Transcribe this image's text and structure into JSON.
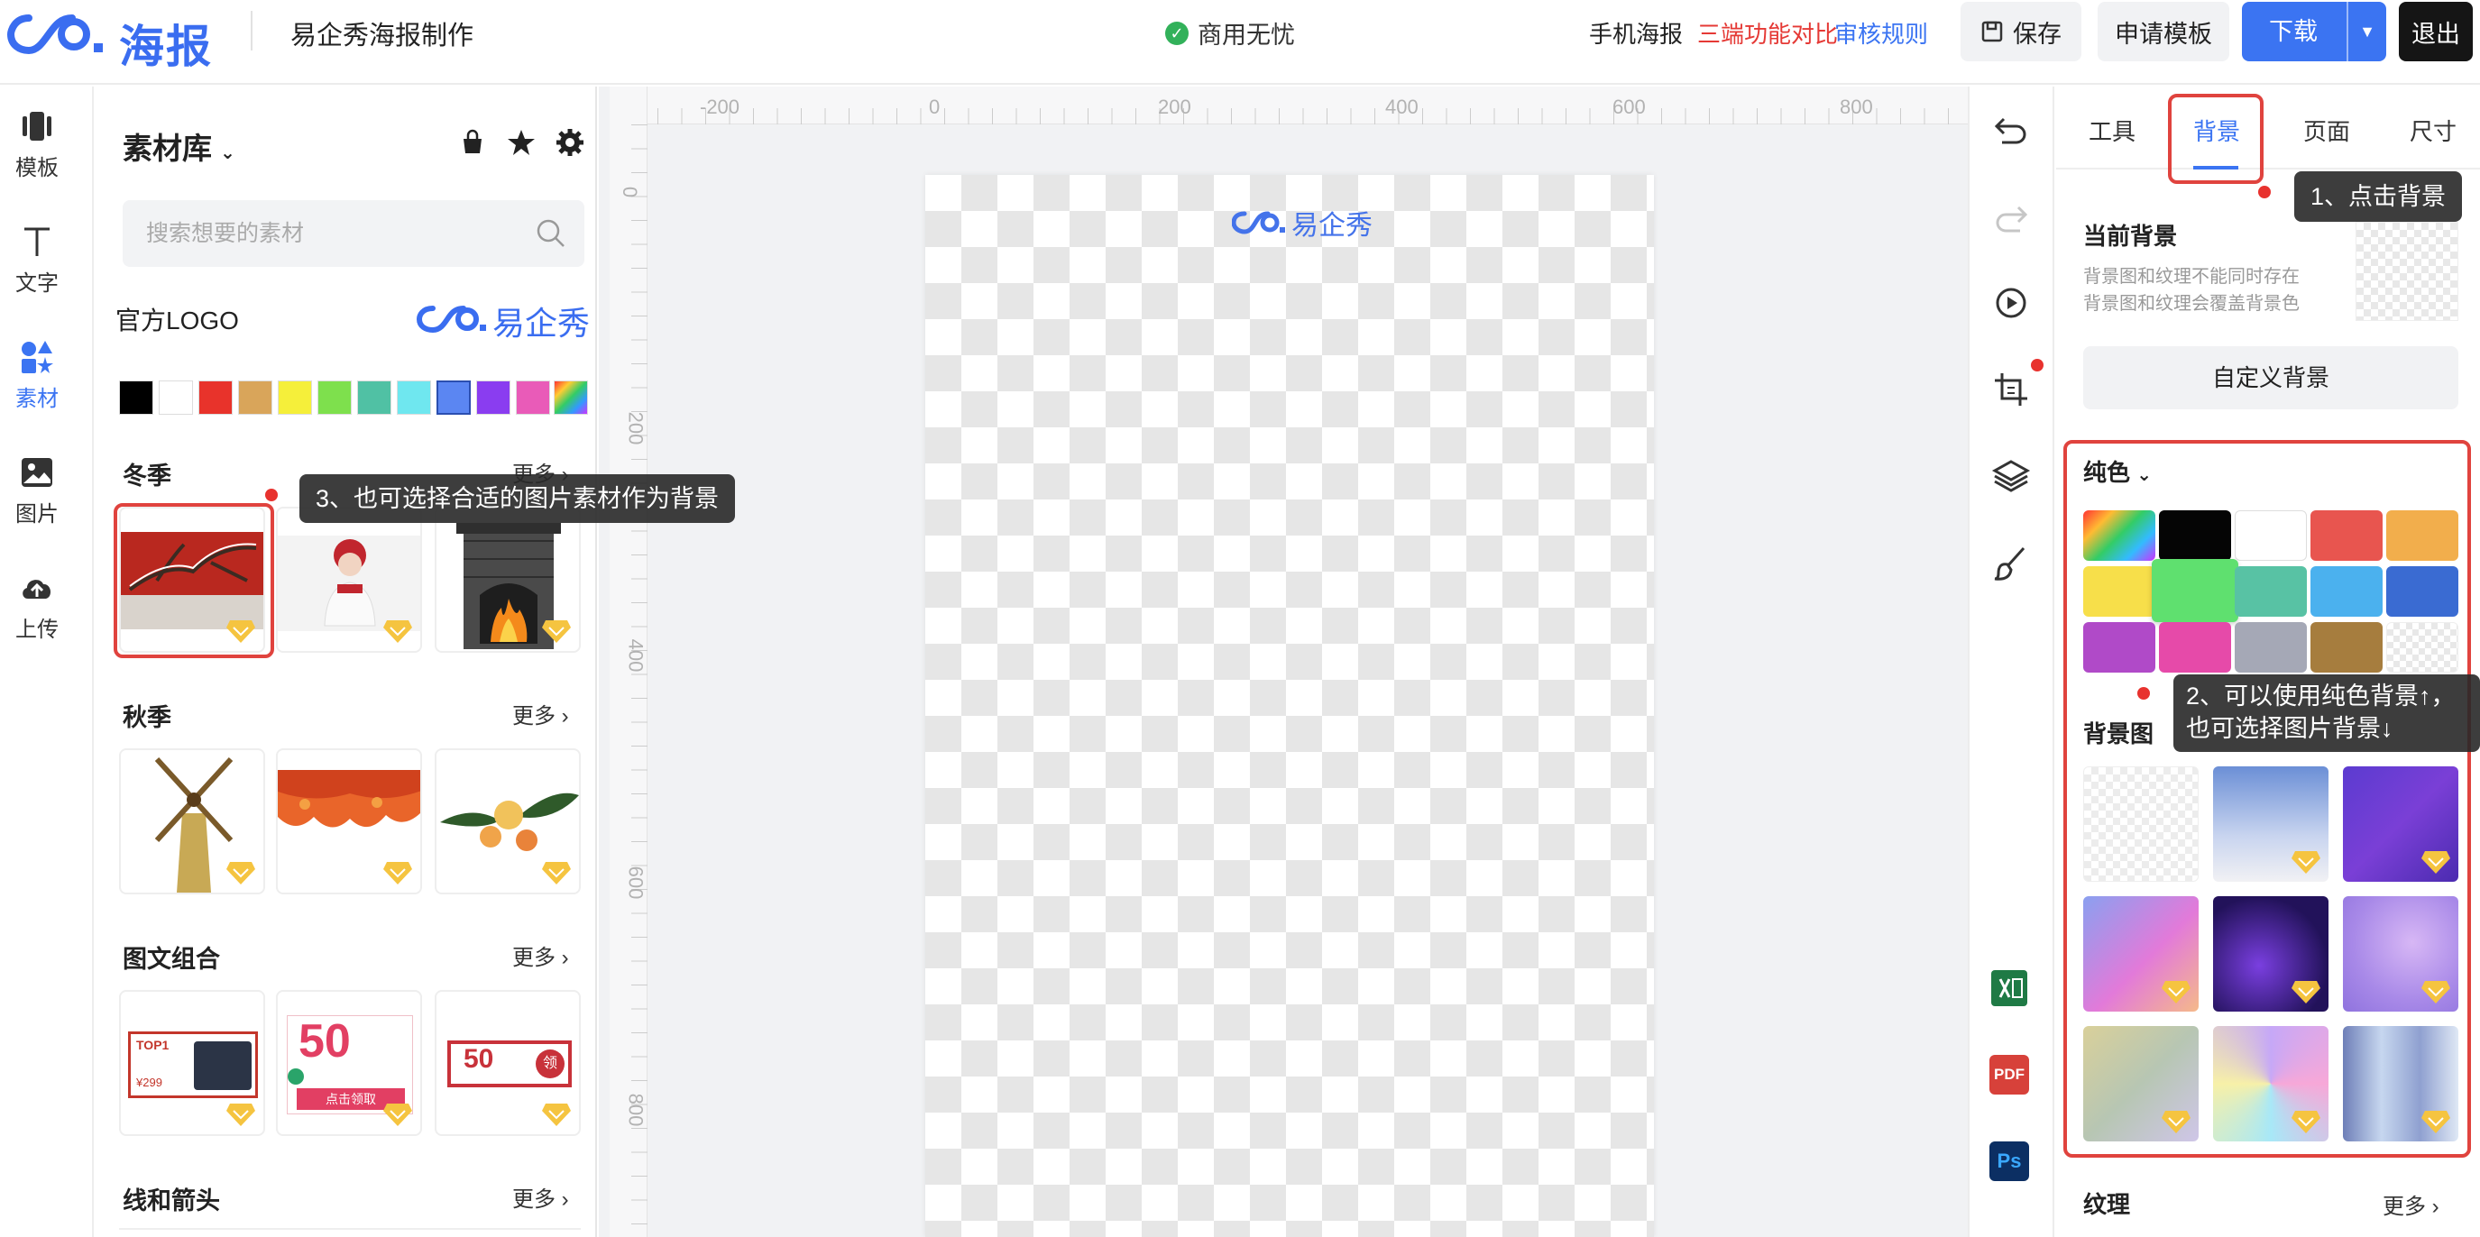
{
  "header": {
    "brand_text": "海报",
    "app_title": "易企秀海报制作",
    "commercial_label": "商用无忧",
    "links": {
      "mobile_poster": "手机海报",
      "compare": "三端功能对比",
      "review_rules": "审核规则"
    },
    "buttons": {
      "save": "保存",
      "apply_template": "申请模板",
      "download": "下载",
      "exit": "退出"
    }
  },
  "left_nav": [
    {
      "label": "模板",
      "icon": "template-icon"
    },
    {
      "label": "文字",
      "icon": "text-icon"
    },
    {
      "label": "素材",
      "icon": "material-icon",
      "active": true
    },
    {
      "label": "图片",
      "icon": "image-icon"
    },
    {
      "label": "上传",
      "icon": "upload-icon"
    }
  ],
  "material": {
    "title": "素材库",
    "search_placeholder": "搜索想要的素材",
    "logo_section": {
      "title": "官方LOGO",
      "logo_text": "易企秀"
    },
    "swatches": [
      "#000000",
      "#ffffff",
      "#e8332b",
      "#d9a55a",
      "#f5ef3a",
      "#7ee04d",
      "#50c1a4",
      "#6fe7ef",
      "#5b86f2",
      "#8a3df0",
      "#e95bb8",
      "rainbow"
    ],
    "more_label": "更多",
    "sections": [
      {
        "title": "冬季",
        "items": [
          "winter-red-wall",
          "winter-woman",
          "winter-fireplace"
        ]
      },
      {
        "title": "秋季",
        "items": [
          "autumn-windmill",
          "autumn-leaves",
          "autumn-flowers"
        ]
      },
      {
        "title": "图文组合",
        "items": [
          "combo-top1",
          "combo-50-coupon",
          "combo-50-red"
        ],
        "texts": {
          "top1": "TOP1",
          "price": "¥299",
          "fifty": "50",
          "claim": "点击领取",
          "coupon": "领"
        }
      },
      {
        "title": "线和箭头",
        "items": []
      }
    ]
  },
  "canvas": {
    "ruler_x": [
      "-200",
      "0",
      "200",
      "400",
      "600",
      "800"
    ],
    "ruler_y": [
      "0",
      "200",
      "400",
      "600",
      "800"
    ],
    "poster_logo_text": "易企秀"
  },
  "right_panel": {
    "tabs": [
      "工具",
      "背景",
      "页面",
      "尺寸"
    ],
    "active_tab": "背景",
    "current_bg": {
      "title": "当前背景",
      "desc1": "背景图和纹理不能同时存在",
      "desc2": "背景图和纹理会覆盖背景色"
    },
    "custom_bg_button": "自定义背景",
    "solid_color": {
      "title": "纯色",
      "colors": [
        "rainbow",
        "#050505",
        "#ffffff",
        "#e8554f",
        "#f2ae4c",
        "#f7df4a",
        "#5fe06f",
        "#58c2a4",
        "#4bb1ee",
        "#3a6bd2",
        "#b04ac8",
        "#e64aa9",
        "#a5a8b6",
        "#a67d3e",
        "transparent"
      ]
    },
    "bg_image": {
      "title": "背景图",
      "more_label": "更多"
    },
    "texture": {
      "title": "纹理",
      "more_label": "更多"
    }
  },
  "tooltips": {
    "step1": "1、点击背景",
    "step2_line1": "2、可以使用纯色背景↑，",
    "step2_line2": "也可选择图片背景↓",
    "step3": "3、也可选择合适的图片素材作为背景"
  },
  "colors": {
    "accent": "#3b74f2",
    "highlight_red": "#e0433e",
    "link_red": "#e53935",
    "link_blue": "#3b74f2"
  }
}
